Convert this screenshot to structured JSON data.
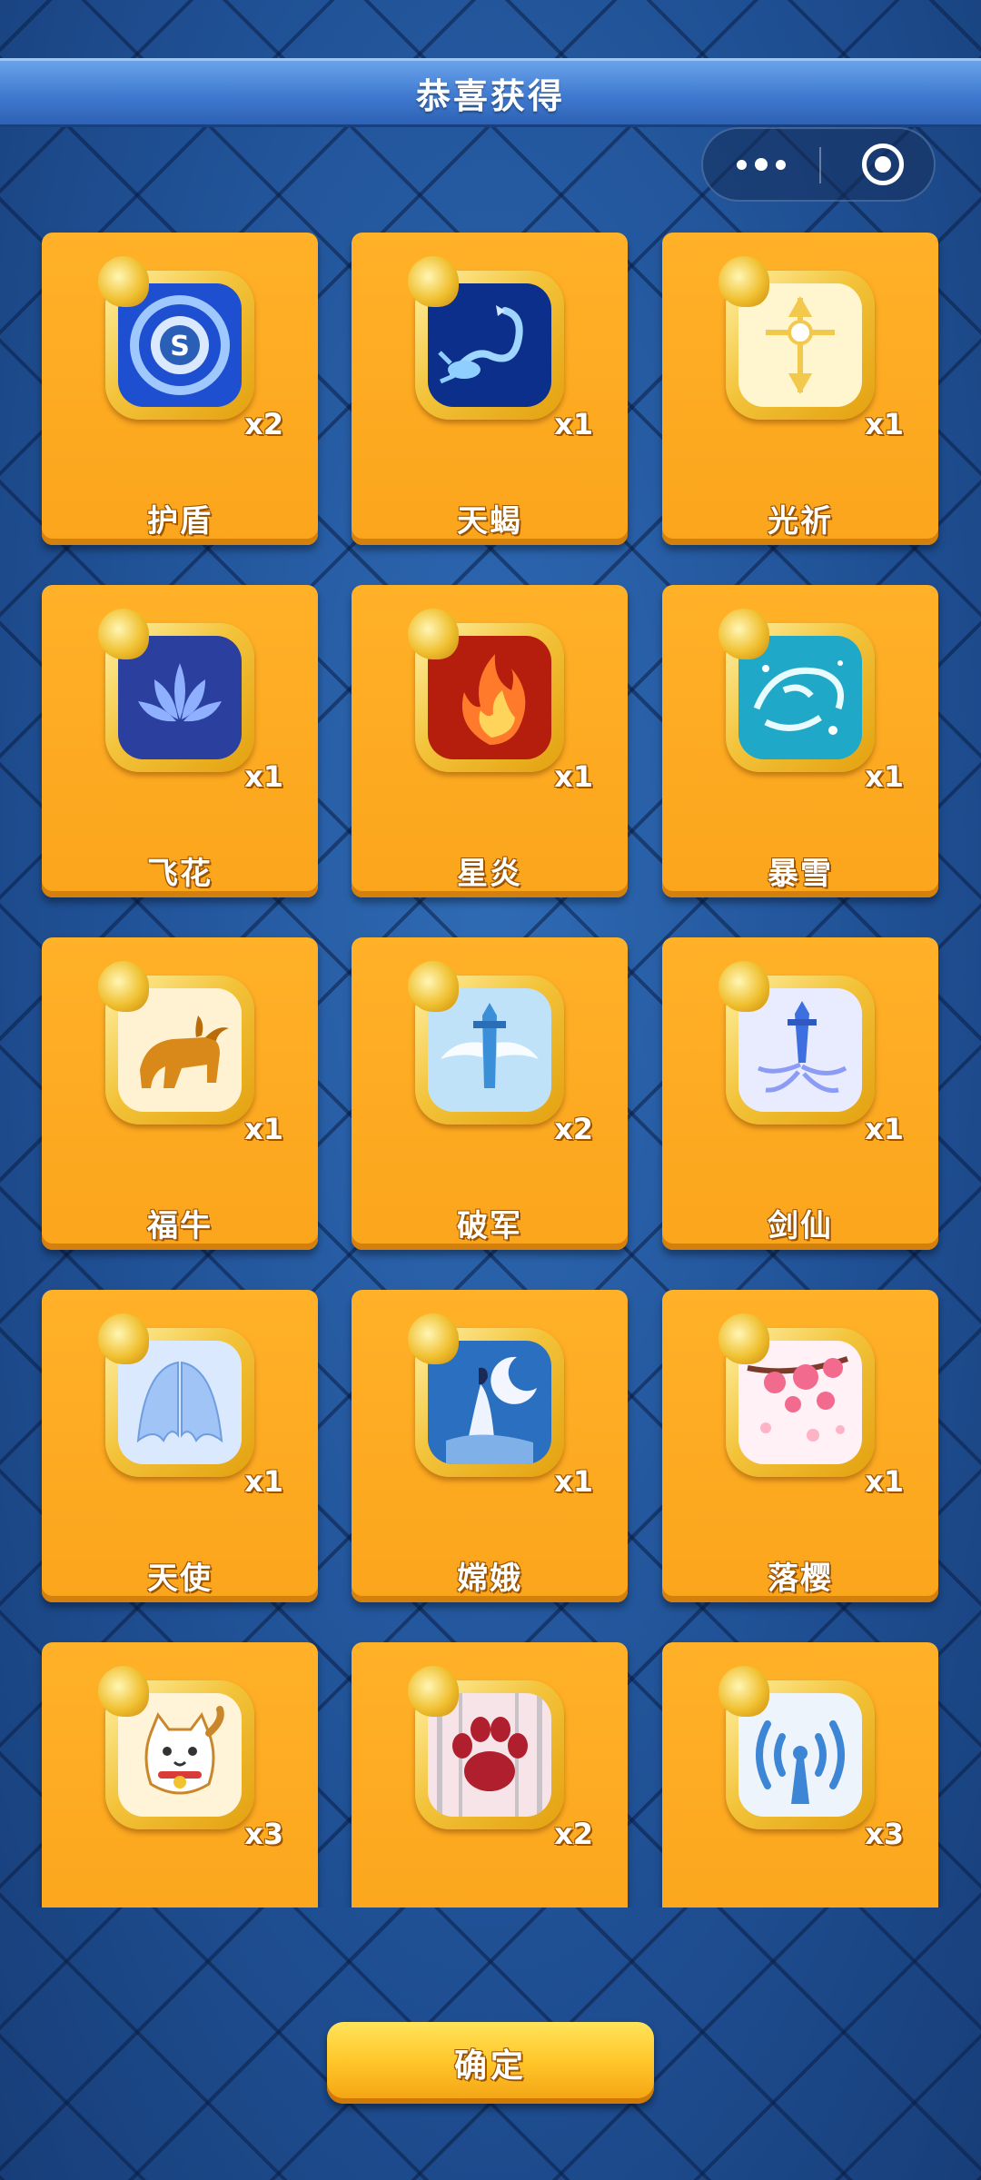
{
  "header": {
    "title": "恭喜获得"
  },
  "capsule": {
    "more_icon": "more-dots-icon",
    "close_icon": "target-close-icon"
  },
  "rewards": [
    {
      "name": "护盾",
      "count": "x2",
      "icon": "shield-coin-icon",
      "color": "#1e4fd0"
    },
    {
      "name": "天蝎",
      "count": "x1",
      "icon": "scorpion-icon",
      "color": "#0b2f8a"
    },
    {
      "name": "光祈",
      "count": "x1",
      "icon": "light-cross-icon",
      "color": "#fff6d0"
    },
    {
      "name": "飞花",
      "count": "x1",
      "icon": "lotus-flower-icon",
      "color": "#2a3f9e"
    },
    {
      "name": "星炎",
      "count": "x1",
      "icon": "flame-icon",
      "color": "#b51e0c"
    },
    {
      "name": "暴雪",
      "count": "x1",
      "icon": "blizzard-swirl-icon",
      "color": "#1fa8c8"
    },
    {
      "name": "福牛",
      "count": "x1",
      "icon": "ox-icon",
      "color": "#fff2d2"
    },
    {
      "name": "破军",
      "count": "x2",
      "icon": "sword-wings-icon",
      "color": "#bfe2f8"
    },
    {
      "name": "剑仙",
      "count": "x1",
      "icon": "sword-spirit-icon",
      "color": "#e9ecff"
    },
    {
      "name": "天使",
      "count": "x1",
      "icon": "angel-wings-icon",
      "color": "#dbe9ff"
    },
    {
      "name": "嫦娥",
      "count": "x1",
      "icon": "moon-goddess-icon",
      "color": "#2b6fc0"
    },
    {
      "name": "落樱",
      "count": "x1",
      "icon": "cherry-blossom-icon",
      "color": "#fff1f5"
    },
    {
      "name": "",
      "count": "x3",
      "icon": "lucky-cat-icon",
      "color": "#fff3d8"
    },
    {
      "name": "",
      "count": "x2",
      "icon": "paw-print-icon",
      "color": "#f7e4e8"
    },
    {
      "name": "",
      "count": "x3",
      "icon": "signal-tower-icon",
      "color": "#eef4fb"
    }
  ],
  "confirm_button": {
    "label": "确定"
  }
}
